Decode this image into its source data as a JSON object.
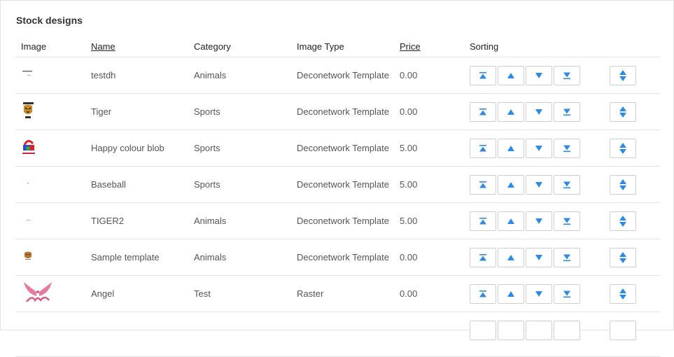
{
  "section_title": "Stock designs",
  "columns": {
    "image": "Image",
    "name": "Name",
    "category": "Category",
    "image_type": "Image Type",
    "price": "Price",
    "sorting": "Sorting"
  },
  "colors": {
    "accent": "#2b8ae6",
    "border": "#e3e3e3"
  },
  "rows": [
    {
      "thumb": "text-logo",
      "name": "testdh",
      "category": "Animals",
      "image_type": "Deconetwork Template",
      "price": "0.00"
    },
    {
      "thumb": "tiger-badge",
      "name": "Tiger",
      "category": "Sports",
      "image_type": "Deconetwork Template",
      "price": "0.00"
    },
    {
      "thumb": "colour-blob",
      "name": "Happy colour blob",
      "category": "Sports",
      "image_type": "Deconetwork Template",
      "price": "5.00"
    },
    {
      "thumb": "tiny-dot",
      "name": "Baseball",
      "category": "Sports",
      "image_type": "Deconetwork Template",
      "price": "5.00"
    },
    {
      "thumb": "tiny-dash",
      "name": "TIGER2",
      "category": "Animals",
      "image_type": "Deconetwork Template",
      "price": "5.00"
    },
    {
      "thumb": "tiger-small",
      "name": "Sample template",
      "category": "Animals",
      "image_type": "Deconetwork Template",
      "price": "0.00"
    },
    {
      "thumb": "angel-wings",
      "name": "Angel",
      "category": "Test",
      "image_type": "Raster",
      "price": "0.00"
    }
  ],
  "icons": {
    "move_top": "move-to-top-icon",
    "move_up": "move-up-icon",
    "move_down": "move-down-icon",
    "move_bottom": "move-to-bottom-icon",
    "drag": "drag-reorder-icon"
  }
}
